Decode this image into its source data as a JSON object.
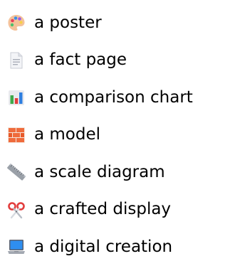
{
  "items": [
    {
      "icon": "artist-palette-icon",
      "label": "a poster"
    },
    {
      "icon": "page-document-icon",
      "label": "a fact page"
    },
    {
      "icon": "bar-chart-icon",
      "label": "a comparison chart"
    },
    {
      "icon": "brick-icon",
      "label": "a model"
    },
    {
      "icon": "ruler-icon",
      "label": "a scale diagram"
    },
    {
      "icon": "scissors-icon",
      "label": "a crafted display"
    },
    {
      "icon": "laptop-icon",
      "label": "a digital creation"
    }
  ]
}
